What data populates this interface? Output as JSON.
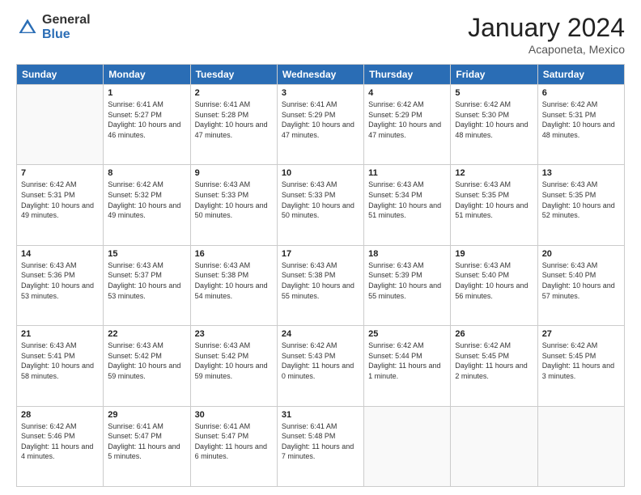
{
  "logo": {
    "general": "General",
    "blue": "Blue"
  },
  "header": {
    "month": "January 2024",
    "location": "Acaponeta, Mexico"
  },
  "days_of_week": [
    "Sunday",
    "Monday",
    "Tuesday",
    "Wednesday",
    "Thursday",
    "Friday",
    "Saturday"
  ],
  "weeks": [
    [
      {
        "day": "",
        "sunrise": "",
        "sunset": "",
        "daylight": "",
        "empty": true
      },
      {
        "day": "1",
        "sunrise": "Sunrise: 6:41 AM",
        "sunset": "Sunset: 5:27 PM",
        "daylight": "Daylight: 10 hours and 46 minutes.",
        "empty": false
      },
      {
        "day": "2",
        "sunrise": "Sunrise: 6:41 AM",
        "sunset": "Sunset: 5:28 PM",
        "daylight": "Daylight: 10 hours and 47 minutes.",
        "empty": false
      },
      {
        "day": "3",
        "sunrise": "Sunrise: 6:41 AM",
        "sunset": "Sunset: 5:29 PM",
        "daylight": "Daylight: 10 hours and 47 minutes.",
        "empty": false
      },
      {
        "day": "4",
        "sunrise": "Sunrise: 6:42 AM",
        "sunset": "Sunset: 5:29 PM",
        "daylight": "Daylight: 10 hours and 47 minutes.",
        "empty": false
      },
      {
        "day": "5",
        "sunrise": "Sunrise: 6:42 AM",
        "sunset": "Sunset: 5:30 PM",
        "daylight": "Daylight: 10 hours and 48 minutes.",
        "empty": false
      },
      {
        "day": "6",
        "sunrise": "Sunrise: 6:42 AM",
        "sunset": "Sunset: 5:31 PM",
        "daylight": "Daylight: 10 hours and 48 minutes.",
        "empty": false
      }
    ],
    [
      {
        "day": "7",
        "sunrise": "Sunrise: 6:42 AM",
        "sunset": "Sunset: 5:31 PM",
        "daylight": "Daylight: 10 hours and 49 minutes.",
        "empty": false
      },
      {
        "day": "8",
        "sunrise": "Sunrise: 6:42 AM",
        "sunset": "Sunset: 5:32 PM",
        "daylight": "Daylight: 10 hours and 49 minutes.",
        "empty": false
      },
      {
        "day": "9",
        "sunrise": "Sunrise: 6:43 AM",
        "sunset": "Sunset: 5:33 PM",
        "daylight": "Daylight: 10 hours and 50 minutes.",
        "empty": false
      },
      {
        "day": "10",
        "sunrise": "Sunrise: 6:43 AM",
        "sunset": "Sunset: 5:33 PM",
        "daylight": "Daylight: 10 hours and 50 minutes.",
        "empty": false
      },
      {
        "day": "11",
        "sunrise": "Sunrise: 6:43 AM",
        "sunset": "Sunset: 5:34 PM",
        "daylight": "Daylight: 10 hours and 51 minutes.",
        "empty": false
      },
      {
        "day": "12",
        "sunrise": "Sunrise: 6:43 AM",
        "sunset": "Sunset: 5:35 PM",
        "daylight": "Daylight: 10 hours and 51 minutes.",
        "empty": false
      },
      {
        "day": "13",
        "sunrise": "Sunrise: 6:43 AM",
        "sunset": "Sunset: 5:35 PM",
        "daylight": "Daylight: 10 hours and 52 minutes.",
        "empty": false
      }
    ],
    [
      {
        "day": "14",
        "sunrise": "Sunrise: 6:43 AM",
        "sunset": "Sunset: 5:36 PM",
        "daylight": "Daylight: 10 hours and 53 minutes.",
        "empty": false
      },
      {
        "day": "15",
        "sunrise": "Sunrise: 6:43 AM",
        "sunset": "Sunset: 5:37 PM",
        "daylight": "Daylight: 10 hours and 53 minutes.",
        "empty": false
      },
      {
        "day": "16",
        "sunrise": "Sunrise: 6:43 AM",
        "sunset": "Sunset: 5:38 PM",
        "daylight": "Daylight: 10 hours and 54 minutes.",
        "empty": false
      },
      {
        "day": "17",
        "sunrise": "Sunrise: 6:43 AM",
        "sunset": "Sunset: 5:38 PM",
        "daylight": "Daylight: 10 hours and 55 minutes.",
        "empty": false
      },
      {
        "day": "18",
        "sunrise": "Sunrise: 6:43 AM",
        "sunset": "Sunset: 5:39 PM",
        "daylight": "Daylight: 10 hours and 55 minutes.",
        "empty": false
      },
      {
        "day": "19",
        "sunrise": "Sunrise: 6:43 AM",
        "sunset": "Sunset: 5:40 PM",
        "daylight": "Daylight: 10 hours and 56 minutes.",
        "empty": false
      },
      {
        "day": "20",
        "sunrise": "Sunrise: 6:43 AM",
        "sunset": "Sunset: 5:40 PM",
        "daylight": "Daylight: 10 hours and 57 minutes.",
        "empty": false
      }
    ],
    [
      {
        "day": "21",
        "sunrise": "Sunrise: 6:43 AM",
        "sunset": "Sunset: 5:41 PM",
        "daylight": "Daylight: 10 hours and 58 minutes.",
        "empty": false
      },
      {
        "day": "22",
        "sunrise": "Sunrise: 6:43 AM",
        "sunset": "Sunset: 5:42 PM",
        "daylight": "Daylight: 10 hours and 59 minutes.",
        "empty": false
      },
      {
        "day": "23",
        "sunrise": "Sunrise: 6:43 AM",
        "sunset": "Sunset: 5:42 PM",
        "daylight": "Daylight: 10 hours and 59 minutes.",
        "empty": false
      },
      {
        "day": "24",
        "sunrise": "Sunrise: 6:42 AM",
        "sunset": "Sunset: 5:43 PM",
        "daylight": "Daylight: 11 hours and 0 minutes.",
        "empty": false
      },
      {
        "day": "25",
        "sunrise": "Sunrise: 6:42 AM",
        "sunset": "Sunset: 5:44 PM",
        "daylight": "Daylight: 11 hours and 1 minute.",
        "empty": false
      },
      {
        "day": "26",
        "sunrise": "Sunrise: 6:42 AM",
        "sunset": "Sunset: 5:45 PM",
        "daylight": "Daylight: 11 hours and 2 minutes.",
        "empty": false
      },
      {
        "day": "27",
        "sunrise": "Sunrise: 6:42 AM",
        "sunset": "Sunset: 5:45 PM",
        "daylight": "Daylight: 11 hours and 3 minutes.",
        "empty": false
      }
    ],
    [
      {
        "day": "28",
        "sunrise": "Sunrise: 6:42 AM",
        "sunset": "Sunset: 5:46 PM",
        "daylight": "Daylight: 11 hours and 4 minutes.",
        "empty": false
      },
      {
        "day": "29",
        "sunrise": "Sunrise: 6:41 AM",
        "sunset": "Sunset: 5:47 PM",
        "daylight": "Daylight: 11 hours and 5 minutes.",
        "empty": false
      },
      {
        "day": "30",
        "sunrise": "Sunrise: 6:41 AM",
        "sunset": "Sunset: 5:47 PM",
        "daylight": "Daylight: 11 hours and 6 minutes.",
        "empty": false
      },
      {
        "day": "31",
        "sunrise": "Sunrise: 6:41 AM",
        "sunset": "Sunset: 5:48 PM",
        "daylight": "Daylight: 11 hours and 7 minutes.",
        "empty": false
      },
      {
        "day": "",
        "sunrise": "",
        "sunset": "",
        "daylight": "",
        "empty": true
      },
      {
        "day": "",
        "sunrise": "",
        "sunset": "",
        "daylight": "",
        "empty": true
      },
      {
        "day": "",
        "sunrise": "",
        "sunset": "",
        "daylight": "",
        "empty": true
      }
    ]
  ]
}
